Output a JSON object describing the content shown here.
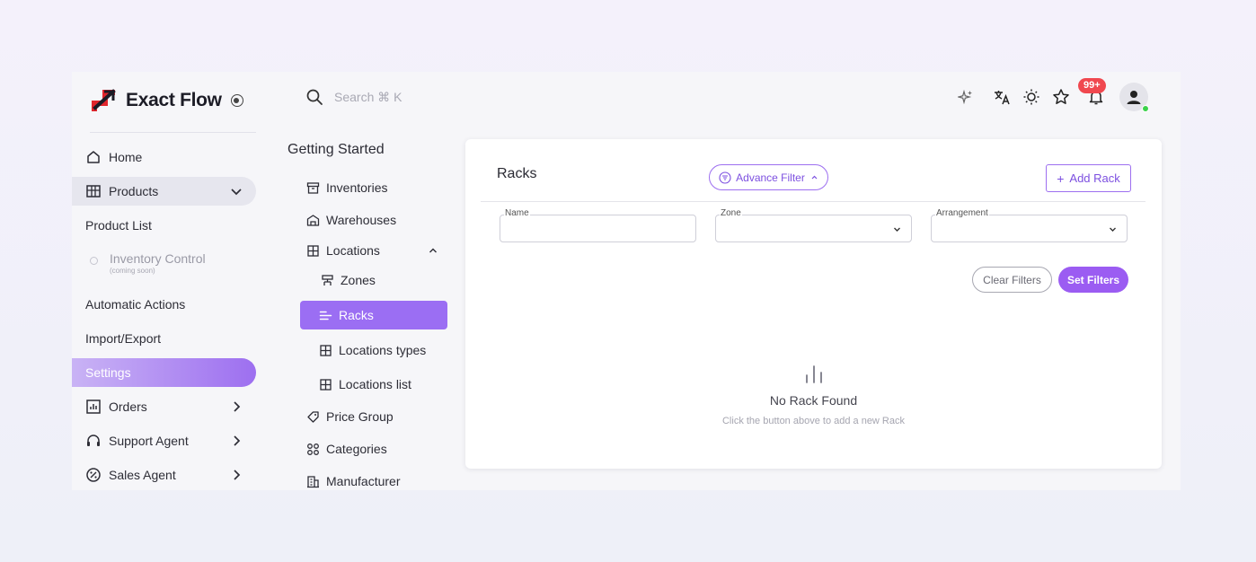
{
  "brand": {
    "name": "Exact Flow"
  },
  "search": {
    "placeholder": "Search ⌘ K",
    "icon": "search-icon"
  },
  "topbar": {
    "icons": [
      "sparkles-icon",
      "translate-icon",
      "sun-icon",
      "star-icon",
      "bell-icon",
      "user-avatar"
    ],
    "notification_count": "99+"
  },
  "sidebar": {
    "items": [
      {
        "label": "Home",
        "icon": "home-icon"
      },
      {
        "label": "Products",
        "icon": "box-icon",
        "expanded": true
      },
      {
        "label": "Product List"
      },
      {
        "label": "Inventory Control",
        "sublabel": "(coming soon)"
      },
      {
        "label": "Automatic Actions"
      },
      {
        "label": "Import/Export"
      },
      {
        "label": "Settings",
        "active": true
      },
      {
        "label": "Orders",
        "icon": "chart-icon"
      },
      {
        "label": "Support Agent",
        "icon": "headset-icon"
      },
      {
        "label": "Sales Agent",
        "icon": "badge-percent-icon"
      }
    ]
  },
  "subnav": {
    "title": "Getting Started",
    "items": [
      {
        "label": "Inventories",
        "icon": "archive-icon"
      },
      {
        "label": "Warehouses",
        "icon": "warehouse-icon"
      },
      {
        "label": "Locations",
        "icon": "grid-icon",
        "expanded": true
      },
      {
        "label": "Zones",
        "icon": "zones-icon"
      },
      {
        "label": "Racks",
        "icon": "racks-icon",
        "active": true
      },
      {
        "label": "Locations types",
        "icon": "grid-icon"
      },
      {
        "label": "Locations list",
        "icon": "grid-icon"
      },
      {
        "label": "Price Group",
        "icon": "tag-icon"
      },
      {
        "label": "Categories",
        "icon": "categories-icon"
      },
      {
        "label": "Manufacturer",
        "icon": "building-icon"
      }
    ]
  },
  "main": {
    "title": "Racks",
    "advance_filter": "Advance Filter",
    "add_button": "Add Rack",
    "filters": {
      "name": {
        "label": "Name",
        "value": ""
      },
      "zone": {
        "label": "Zone",
        "value": ""
      },
      "arrangement": {
        "label": "Arrangement",
        "value": ""
      }
    },
    "clear_filters": "Clear Filters",
    "set_filters": "Set Filters",
    "empty": {
      "title": "No Rack Found",
      "subtitle": "Click the button above to add a new Rack"
    }
  },
  "colors": {
    "accent": "#9b5cf2",
    "accent_text": "#7c4fe0",
    "notification": "#f0484f",
    "online": "#3bd14a"
  }
}
